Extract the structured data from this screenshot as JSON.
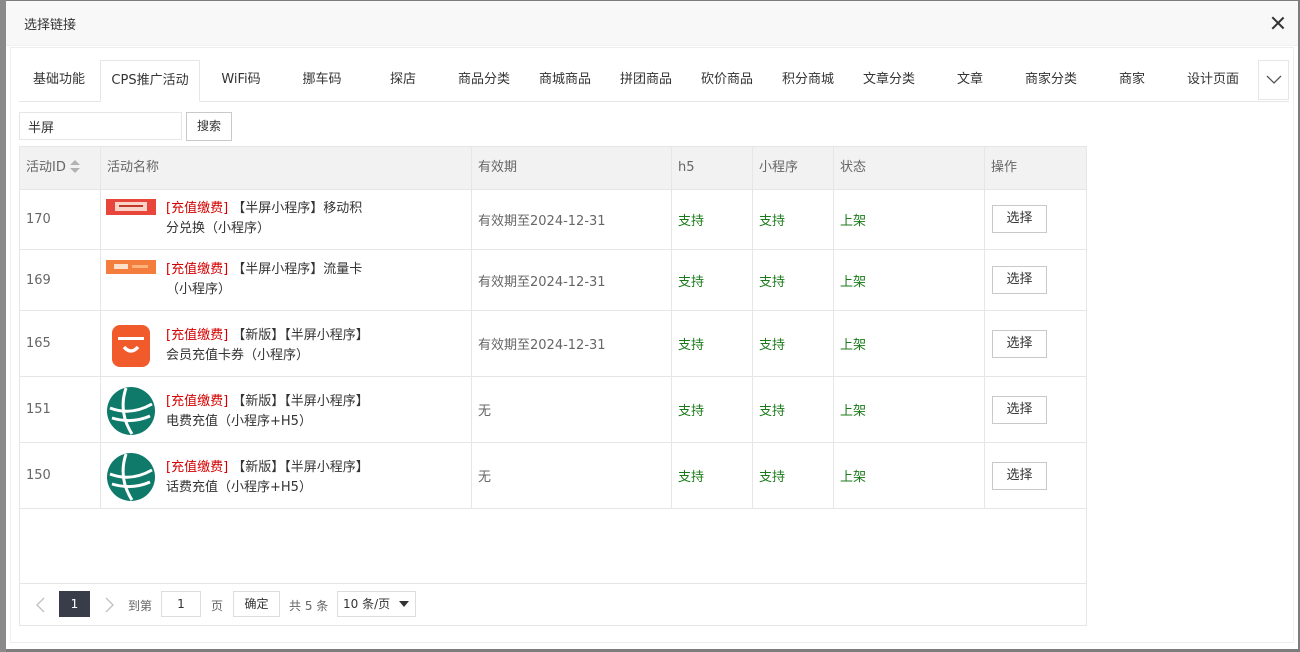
{
  "dialog": {
    "title": "选择链接"
  },
  "tabs": [
    {
      "label": "基础功能"
    },
    {
      "label": "CPS推广活动",
      "active": true
    },
    {
      "label": "WiFi码"
    },
    {
      "label": "挪车码"
    },
    {
      "label": "探店"
    },
    {
      "label": "商品分类"
    },
    {
      "label": "商城商品"
    },
    {
      "label": "拼团商品"
    },
    {
      "label": "砍价商品"
    },
    {
      "label": "积分商城"
    },
    {
      "label": "文章分类"
    },
    {
      "label": "文章"
    },
    {
      "label": "商家分类"
    },
    {
      "label": "商家"
    },
    {
      "label": "设计页面"
    }
  ],
  "search": {
    "value": "半屏",
    "button": "搜索"
  },
  "table": {
    "columns": [
      "活动ID",
      "活动名称",
      "有效期",
      "h5",
      "小程序",
      "状态",
      "操作"
    ],
    "rows": [
      {
        "id": "170",
        "tag": "[充值缴费]",
        "name": "【半屏小程序】移动积分兑换（小程序）",
        "thumb": "red-banner",
        "validity": "有效期至2024-12-31",
        "h5": "支持",
        "mp": "支持",
        "status": "上架",
        "action": "选择"
      },
      {
        "id": "169",
        "tag": "[充值缴费]",
        "name": "【半屏小程序】流量卡（小程序）",
        "thumb": "orange-banner",
        "validity": "有效期至2024-12-31",
        "h5": "支持",
        "mp": "支持",
        "status": "上架",
        "action": "选择"
      },
      {
        "id": "165",
        "tag": "[充值缴费]",
        "name": "【新版】【半屏小程序】会员充值卡券（小程序）",
        "thumb": "red-bag-icon",
        "validity": "有效期至2024-12-31",
        "h5": "支持",
        "mp": "支持",
        "status": "上架",
        "action": "选择"
      },
      {
        "id": "151",
        "tag": "[充值缴费]",
        "name": "【新版】【半屏小程序】电费充值（小程序+H5）",
        "thumb": "teal-globe-icon",
        "validity": "无",
        "h5": "支持",
        "mp": "支持",
        "status": "上架",
        "action": "选择"
      },
      {
        "id": "150",
        "tag": "[充值缴费]",
        "name": "【新版】【半屏小程序】话费充值（小程序+H5）",
        "thumb": "teal-globe-icon",
        "validity": "无",
        "h5": "支持",
        "mp": "支持",
        "status": "上架",
        "action": "选择"
      }
    ]
  },
  "pager": {
    "current": "1",
    "goto_label": "到第",
    "goto_value": "1",
    "page_label": "页",
    "ok": "确定",
    "total": "共 5 条",
    "page_size": "10 条/页"
  },
  "colors": {
    "accent_green": "#1a7a1a",
    "tag_red": "#d40000",
    "pager_active": "#393d49"
  }
}
